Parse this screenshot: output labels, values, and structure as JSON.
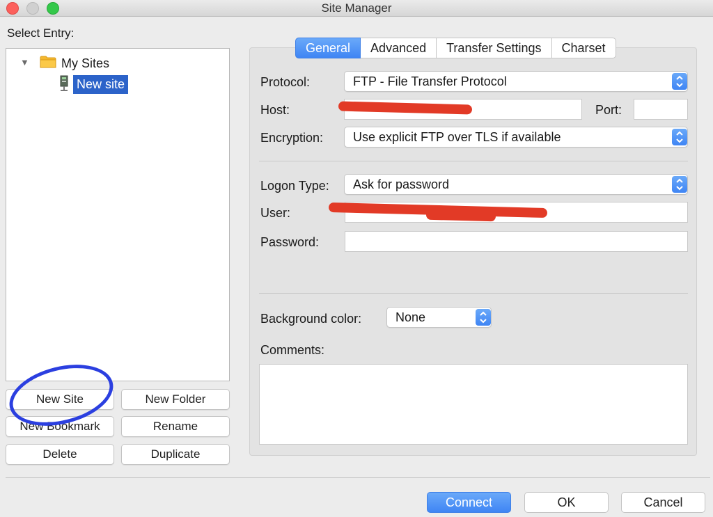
{
  "window": {
    "title": "Site Manager"
  },
  "sidebar": {
    "select_label": "Select Entry:",
    "tree": {
      "folder_label": "My Sites",
      "site_label": "New site"
    },
    "buttons": {
      "new_site": "New Site",
      "new_folder": "New Folder",
      "new_bookmark": "New Bookmark",
      "rename": "Rename",
      "delete": "Delete",
      "duplicate": "Duplicate"
    }
  },
  "tabs": [
    {
      "label": "General",
      "active": true
    },
    {
      "label": "Advanced",
      "active": false
    },
    {
      "label": "Transfer Settings",
      "active": false
    },
    {
      "label": "Charset",
      "active": false
    }
  ],
  "general": {
    "protocol_label": "Protocol:",
    "protocol_value": "FTP - File Transfer Protocol",
    "host_label": "Host:",
    "port_label": "Port:",
    "port_value": "",
    "encryption_label": "Encryption:",
    "encryption_value": "Use explicit FTP over TLS if available",
    "logon_type_label": "Logon Type:",
    "logon_type_value": "Ask for password",
    "user_label": "User:",
    "password_label": "Password:",
    "background_color_label": "Background color:",
    "background_color_value": "None",
    "comments_label": "Comments:"
  },
  "footer": {
    "connect": "Connect",
    "ok": "OK",
    "cancel": "Cancel"
  },
  "colors": {
    "accent_blue": "#3f85f4",
    "selection_blue": "#2c63c9",
    "redaction_red": "#e23a26",
    "annotation_circle": "#2b3fe0"
  }
}
